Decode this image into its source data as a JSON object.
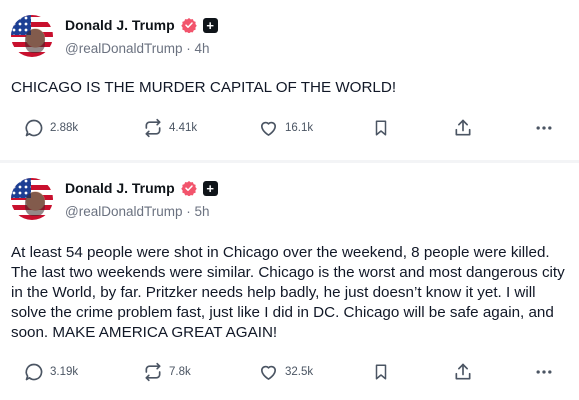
{
  "posts": [
    {
      "author": {
        "display_name": "Donald J. Trump",
        "handle": "@realDonaldTrump",
        "time": "4h",
        "badge_icon": "verified-badge-icon",
        "badge_color": "#f2546c"
      },
      "text": "CHICAGO IS THE MURDER CAPITAL OF THE WORLD!",
      "stats": {
        "replies": "2.88k",
        "reposts": "4.41k",
        "likes": "16.1k"
      }
    },
    {
      "author": {
        "display_name": "Donald J. Trump",
        "handle": "@realDonaldTrump",
        "time": "5h",
        "badge_icon": "verified-badge-icon",
        "badge_color": "#f2546c"
      },
      "text": "At least 54 people were shot in Chicago over the weekend, 8 people were killed. The last two weekends were similar. Chicago is the worst and most dangerous city in the World, by far. Pritzker needs help badly, he just doesn’t know it yet. I will solve the crime problem fast, just like I did in DC. Chicago will be safe again, and soon. MAKE AMERICA GREAT AGAIN!",
      "stats": {
        "replies": "3.19k",
        "reposts": "7.8k",
        "likes": "32.5k"
      }
    }
  ],
  "ui": {
    "plus_badge": "+",
    "separator": " · "
  },
  "colors": {
    "text": "#0f1419",
    "muted": "#6b7280",
    "icon": "#4b5563",
    "verified": "#f2546c",
    "divider": "#f3f4f6"
  }
}
